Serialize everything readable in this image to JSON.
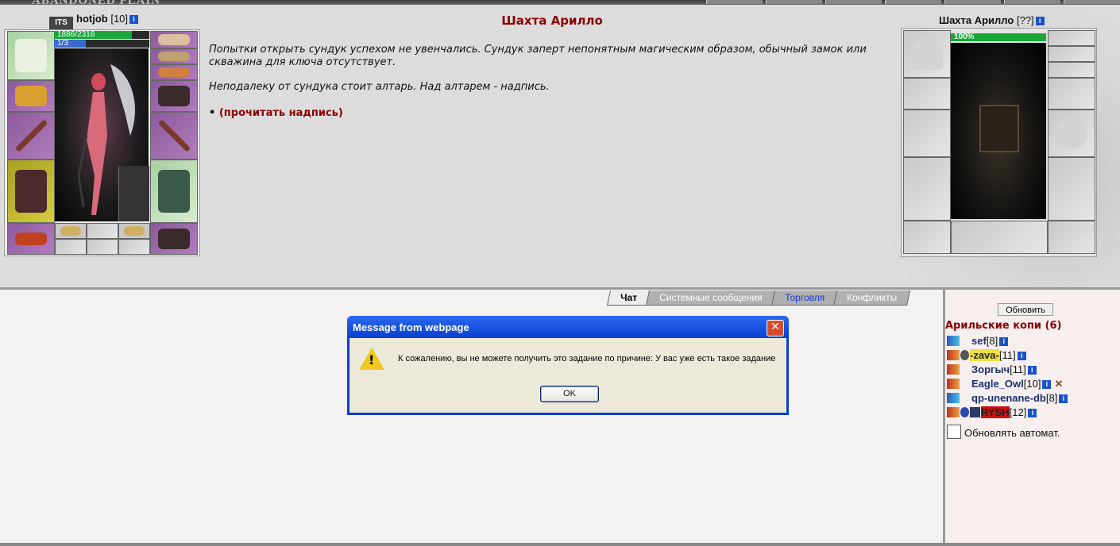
{
  "header": {
    "logo_text": "ABANDONED PLAIN"
  },
  "player": {
    "clan_tag": "ITS",
    "name": "hotjob",
    "level": "[10]",
    "info_icon": "i",
    "hp_text": "1886/2316",
    "hp_fraction": 0.814,
    "mp_text": "1/3",
    "mp_fraction": 0.333
  },
  "location": {
    "title": "Шахта Арилло",
    "paragraph1": "Попытки открыть сундук успехом не увенчались. Сундук заперт непонятным магическим образом, обычный замок или скважина для ключа отсутствует.",
    "paragraph2": "Неподалеку от сундука стоит алтарь. Над алтарем - надпись.",
    "action_bullet": "•",
    "action_label": "(прочитать надпись)"
  },
  "enemy": {
    "name": "Шахта Арилло",
    "level": "[??]",
    "info_icon": "i",
    "hp_text": "100%",
    "hp_fraction": 1.0
  },
  "tabs": [
    {
      "label": "Чат",
      "state": "active"
    },
    {
      "label": "Системные сообщения",
      "state": "normal"
    },
    {
      "label": "Торговля",
      "state": "highlight"
    },
    {
      "label": "Конфликты",
      "state": "normal"
    }
  ],
  "sidebar": {
    "refresh_label": "Обновить",
    "room_title": "Арильские копи (6)",
    "players": [
      {
        "name": "sef",
        "level": "[8]",
        "info": "i"
      },
      {
        "name": "-zava-",
        "level": "[11]",
        "info": "i"
      },
      {
        "name": "Зоргыч",
        "level": "[11]",
        "info": "i"
      },
      {
        "name": "Eagle_Owl",
        "level": "[10]",
        "info": "i",
        "extra": "✕"
      },
      {
        "name": "qp-unenane-db",
        "level": "[8]",
        "info": "i"
      },
      {
        "name": "RYSH",
        "level": "[12]",
        "info": "i"
      }
    ],
    "auto_refresh_label": "Обновлять автомат."
  },
  "dialog": {
    "title": "Message from webpage",
    "close_label": "✕",
    "icon_glyph": "!",
    "message": "К сожалению, вы не можете получить это задание по причине: У вас уже есть такое задание",
    "ok_label": "OK"
  },
  "colors": {
    "accent_red": "#8b0000",
    "link_blue": "#1a3070",
    "dialog_blue": "#0a3ed0",
    "hp_green": "#1aa83a"
  }
}
